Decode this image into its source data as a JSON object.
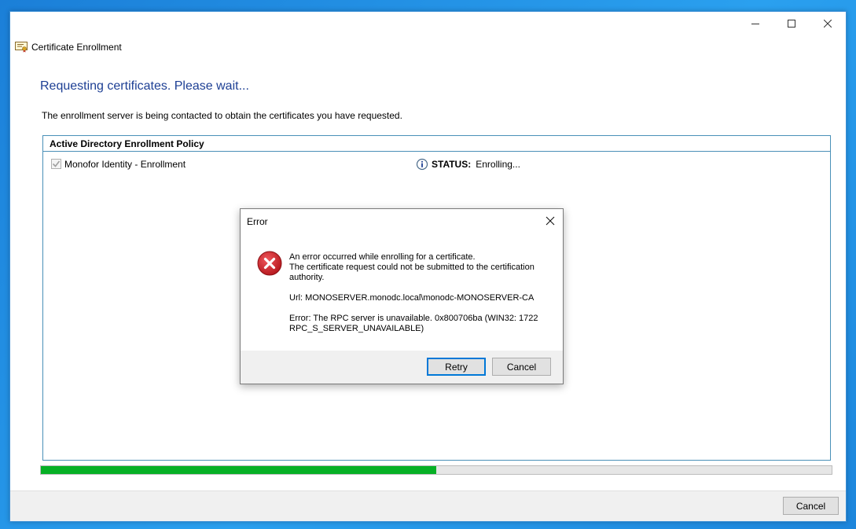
{
  "window": {
    "app_title": "Certificate Enrollment",
    "heading": "Requesting certificates. Please wait...",
    "description": "The enrollment server is being contacted to obtain the certificates you have requested."
  },
  "policy": {
    "header": "Active Directory Enrollment Policy",
    "item_name": "Monofor Identity - Enrollment",
    "item_checked": true,
    "status_label": "STATUS:",
    "status_value": "Enrolling..."
  },
  "progress": {
    "percent": 50
  },
  "footer": {
    "cancel_label": "Cancel"
  },
  "dialog": {
    "title": "Error",
    "message_1": "An error occurred while enrolling for a certificate.\nThe certificate request could not be submitted to the certification authority.",
    "url_line": "Url: MONOSERVER.monodc.local\\monodc-MONOSERVER-CA",
    "error_line": "Error: The RPC server is unavailable. 0x800706ba (WIN32: 1722 RPC_S_SERVER_UNAVAILABLE)",
    "retry_label": "Retry",
    "cancel_label": "Cancel"
  },
  "colors": {
    "heading": "#1d3f94",
    "progress_fill": "#06b025",
    "error_red": "#c42b1c",
    "focus_blue": "#0078d7"
  },
  "icons": {
    "app": "certificate-icon",
    "status": "info-icon",
    "dialog": "error-icon"
  }
}
